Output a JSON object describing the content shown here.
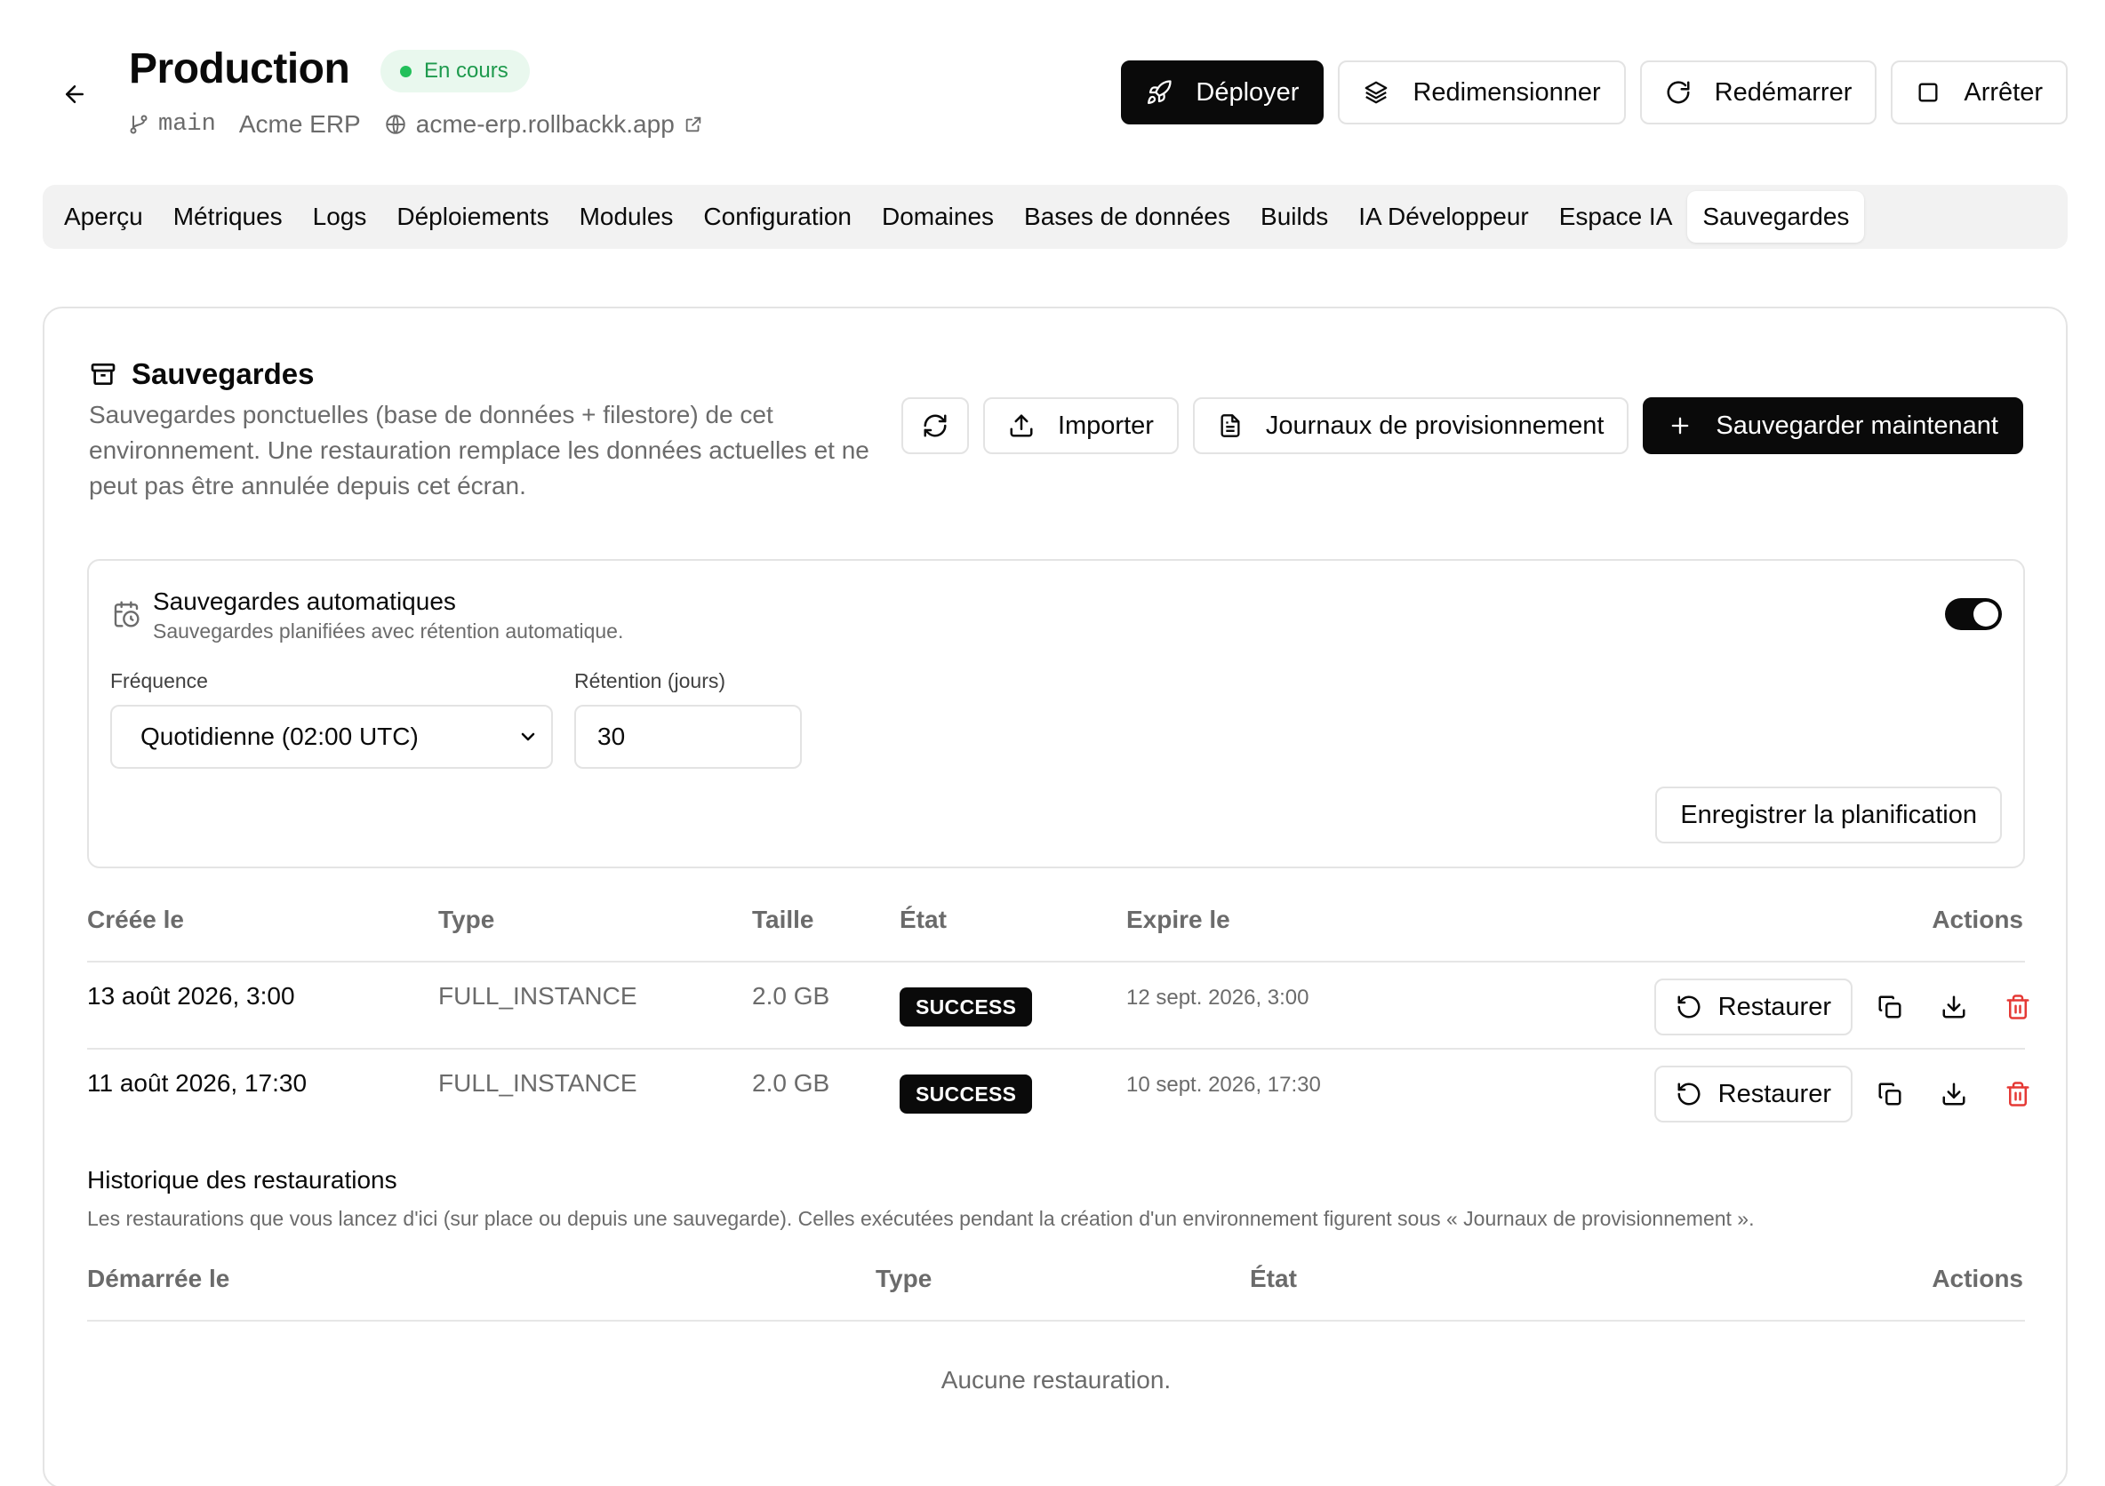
{
  "header": {
    "title": "Production",
    "status": "En cours",
    "branch": "main",
    "project": "Acme ERP",
    "url": "acme-erp.rollbackk.app",
    "actions": {
      "deploy": "Déployer",
      "resize": "Redimensionner",
      "restart": "Redémarrer",
      "stop": "Arrêter"
    }
  },
  "tabs": [
    "Aperçu",
    "Métriques",
    "Logs",
    "Déploiements",
    "Modules",
    "Configuration",
    "Domaines",
    "Bases de données",
    "Builds",
    "IA Développeur",
    "Espace IA",
    "Sauvegardes"
  ],
  "active_tab": "Sauvegardes",
  "backups": {
    "title": "Sauvegardes",
    "description": "Sauvegardes ponctuelles (base de données + filestore) de cet environnement. Une restauration remplace les données actuelles et ne peut pas être annulée depuis cet écran.",
    "import_label": "Importer",
    "logs_label": "Journaux de provisionnement",
    "backup_now_label": "Sauvegarder maintenant",
    "auto": {
      "title": "Sauvegardes automatiques",
      "subtitle": "Sauvegardes planifiées avec rétention automatique.",
      "enabled": true,
      "frequency_label": "Fréquence",
      "frequency_value": "Quotidienne (02:00 UTC)",
      "retention_label": "Rétention (jours)",
      "retention_value": "30",
      "save_label": "Enregistrer la planification"
    },
    "columns": {
      "created": "Créée le",
      "type": "Type",
      "size": "Taille",
      "state": "État",
      "expires": "Expire le",
      "actions": "Actions"
    },
    "rows": [
      {
        "created": "13 août 2026, 3:00",
        "type": "FULL_INSTANCE",
        "size": "2.0 GB",
        "state": "SUCCESS",
        "expires": "12 sept. 2026, 3:00",
        "restore_label": "Restaurer"
      },
      {
        "created": "11 août 2026, 17:30",
        "type": "FULL_INSTANCE",
        "size": "2.0 GB",
        "state": "SUCCESS",
        "expires": "10 sept. 2026, 17:30",
        "restore_label": "Restaurer"
      }
    ]
  },
  "restores": {
    "title": "Historique des restaurations",
    "description": "Les restaurations que vous lancez d'ici (sur place ou depuis une sauvegarde). Celles exécutées pendant la création d'un environnement figurent sous « Journaux de provisionnement ».",
    "columns": {
      "started": "Démarrée le",
      "type": "Type",
      "state": "État",
      "actions": "Actions"
    },
    "empty": "Aucune restauration."
  },
  "colors": {
    "accent": "#0a0a0a",
    "status_green": "#22c05a",
    "status_bg": "#e9f8ee",
    "danger": "#e53935"
  }
}
